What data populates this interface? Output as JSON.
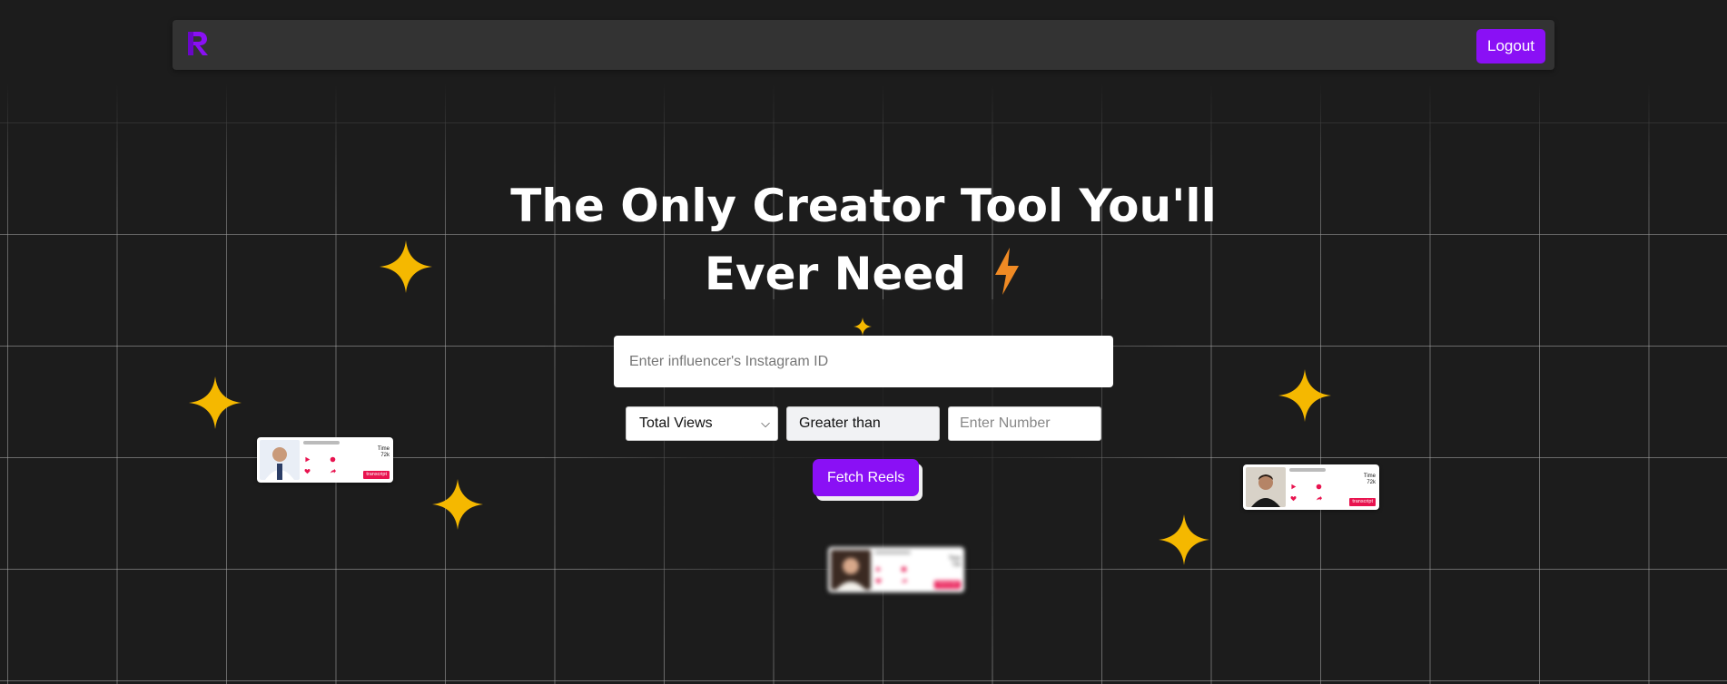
{
  "navbar": {
    "logo_icon": "r-logo-icon",
    "logout_label": "Logout"
  },
  "hero": {
    "title_line1": "The Only Creator Tool You'll",
    "title_line2": "Ever Need",
    "title_icon": "lightning-bolt-icon"
  },
  "search": {
    "placeholder": "Enter influencer's Instagram ID",
    "metric_selected": "Total Views",
    "comparison_selected": "Greater than",
    "number_placeholder": "Enter Number",
    "fetch_label": "Fetch Reels"
  },
  "reel_cards": [
    {
      "meta_line1": "Time",
      "meta_line2": "72k",
      "tag": "transcript"
    },
    {
      "meta_line1": "Time",
      "meta_line2": "72k",
      "tag": "transcript"
    },
    {
      "meta_line1": "Time",
      "meta_line2": "72k",
      "tag": "transcript"
    }
  ],
  "colors": {
    "background": "#1c1c1c",
    "accent": "#8a10f5",
    "sparkle": "#f5b800",
    "bolt": "#f08a24",
    "tag": "#e8134f"
  }
}
